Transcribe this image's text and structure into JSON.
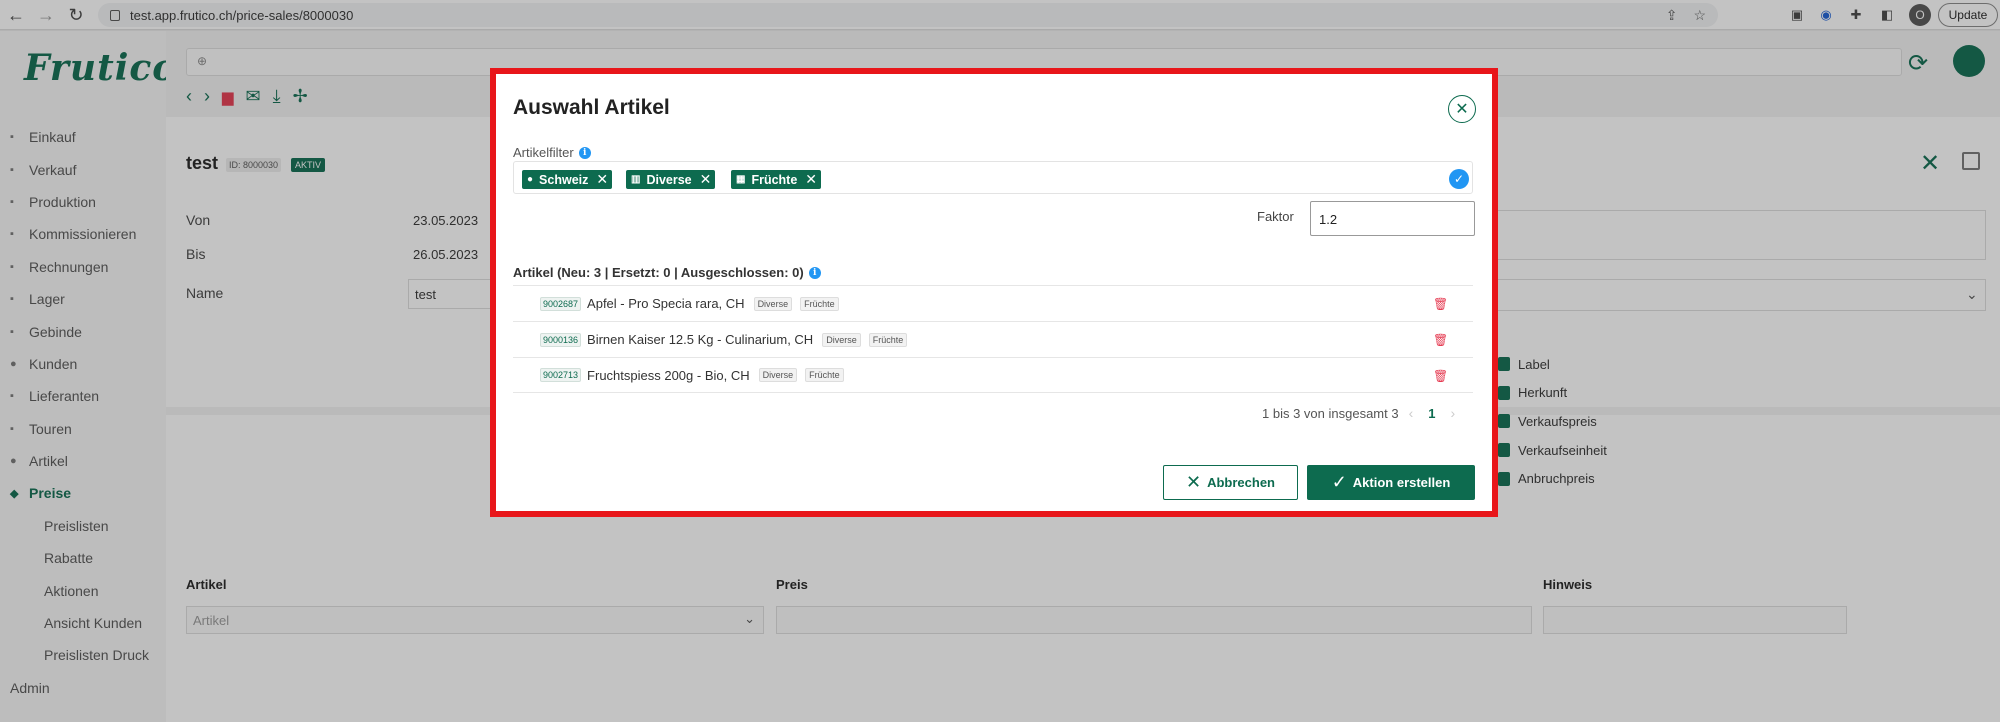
{
  "browser": {
    "url": "test.app.frutico.ch/price-sales/8000030",
    "profile_initial": "O",
    "update_label": "Update"
  },
  "app": {
    "logo": "Frutico",
    "menu": [
      {
        "label": "Einkauf",
        "icon": "cart-icon"
      },
      {
        "label": "Verkauf",
        "icon": "store-icon"
      },
      {
        "label": "Produktion",
        "icon": "production-icon"
      },
      {
        "label": "Kommissionieren",
        "icon": "clipboard-icon"
      },
      {
        "label": "Rechnungen",
        "icon": "invoice-icon"
      },
      {
        "label": "Lager",
        "icon": "warehouse-icon"
      },
      {
        "label": "Gebinde",
        "icon": "box-icon"
      },
      {
        "label": "Kunden",
        "icon": "user-icon"
      },
      {
        "label": "Lieferanten",
        "icon": "truck-icon"
      },
      {
        "label": "Touren",
        "icon": "route-icon"
      },
      {
        "label": "Artikel",
        "icon": "apple-icon"
      },
      {
        "label": "Preise",
        "icon": "tag-icon",
        "active": true
      },
      {
        "label": "Preislisten",
        "sub": true
      },
      {
        "label": "Rabatte",
        "sub": true
      },
      {
        "label": "Aktionen",
        "sub": true
      },
      {
        "label": "Ansicht Kunden",
        "sub": true
      },
      {
        "label": "Preislisten Druck",
        "sub": true
      },
      {
        "label": "Admin",
        "top": true
      }
    ]
  },
  "record": {
    "title": "test",
    "id": "ID: 8000030",
    "status": "AKTIV",
    "von_label": "Von",
    "von": "23.05.2023",
    "bis_label": "Bis",
    "bis": "26.05.2023",
    "name_label": "Name",
    "name": "test",
    "checkboxes": [
      "Label",
      "Herkunft",
      "Verkaufspreis",
      "Verkaufseinheit",
      "Anbruchpreis"
    ]
  },
  "table": {
    "headers": [
      "Artikel",
      "Preis",
      "Hinweis"
    ],
    "artikel_placeholder": "Artikel"
  },
  "modal": {
    "title": "Auswahl Artikel",
    "filter_label": "Artikelfilter",
    "chips": [
      {
        "label": "Schweiz",
        "icon": "location-pin-icon"
      },
      {
        "label": "Diverse",
        "icon": "columns-icon"
      },
      {
        "label": "Früchte",
        "icon": "grid-icon"
      }
    ],
    "faktor_label": "Faktor",
    "faktor_value": "1.2",
    "list_head": "Artikel (Neu: 3 | Ersetzt: 0 | Ausgeschlossen: 0)",
    "articles": [
      {
        "id": "9002687",
        "name": "Apfel - Pro Specia rara, CH",
        "tags": [
          "Diverse",
          "Früchte"
        ]
      },
      {
        "id": "9000136",
        "name": "Birnen Kaiser 12.5 Kg - Culinarium, CH",
        "tags": [
          "Diverse",
          "Früchte"
        ]
      },
      {
        "id": "9002713",
        "name": "Fruchtspiess 200g - Bio, CH",
        "tags": [
          "Diverse",
          "Früchte"
        ]
      }
    ],
    "pagination_text": "1 bis 3 von insgesamt 3",
    "current_page": "1",
    "cancel_label": "Abbrechen",
    "create_label": "Aktion erstellen"
  },
  "colors": {
    "brand": "#0d6b4f",
    "highlight": "#e8161a",
    "info": "#2196f3",
    "danger": "#e53950"
  }
}
